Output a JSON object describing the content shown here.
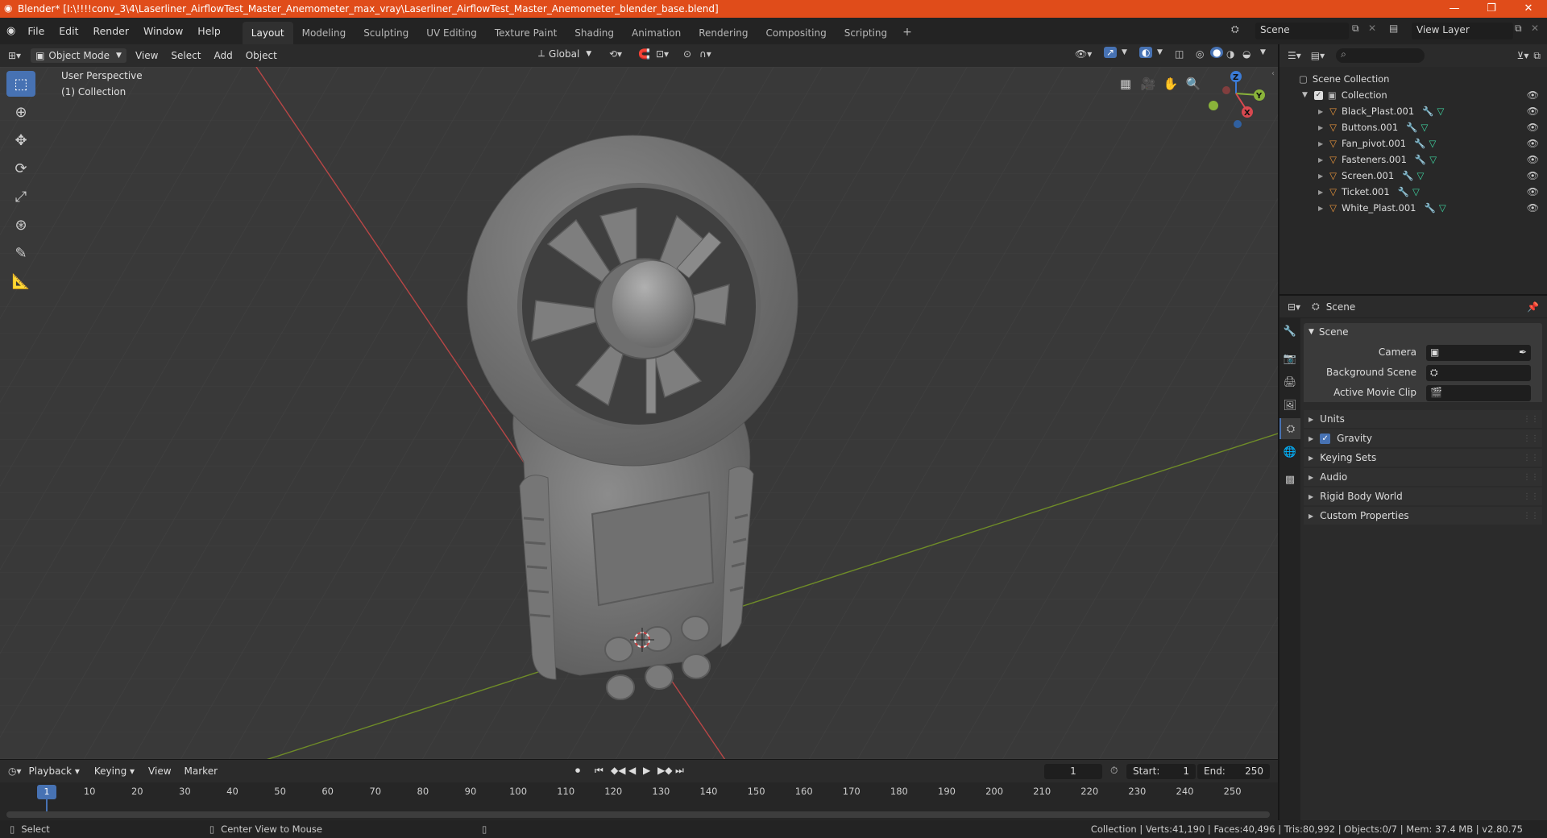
{
  "window": {
    "title": "Blender* [I:\\!!!!conv_3\\4\\Laserliner_AirflowTest_Master_Anemometer_max_vray\\Laserliner_AirflowTest_Master_Anemometer_blender_base.blend]"
  },
  "menu": [
    "File",
    "Edit",
    "Render",
    "Window",
    "Help"
  ],
  "workspaces": [
    {
      "label": "Layout",
      "active": true
    },
    {
      "label": "Modeling",
      "active": false
    },
    {
      "label": "Sculpting",
      "active": false
    },
    {
      "label": "UV Editing",
      "active": false
    },
    {
      "label": "Texture Paint",
      "active": false
    },
    {
      "label": "Shading",
      "active": false
    },
    {
      "label": "Animation",
      "active": false
    },
    {
      "label": "Rendering",
      "active": false
    },
    {
      "label": "Compositing",
      "active": false
    },
    {
      "label": "Scripting",
      "active": false
    }
  ],
  "topright": {
    "scene": "Scene",
    "view_layer": "View Layer",
    "add_tab": "+"
  },
  "viewport_header": {
    "mode": "Object Mode",
    "items": [
      "View",
      "Select",
      "Add",
      "Object"
    ],
    "orientation": "Global"
  },
  "viewport": {
    "perspective": "User Perspective",
    "collection": "(1) Collection",
    "gizmo_axes": {
      "x": "X",
      "y": "Y",
      "z": "Z"
    }
  },
  "outliner": {
    "root": "Scene Collection",
    "collection": "Collection",
    "items": [
      "Black_Plast.001",
      "Buttons.001",
      "Fan_pivot.001",
      "Fasteners.001",
      "Screen.001",
      "Ticket.001",
      "White_Plast.001"
    ]
  },
  "properties": {
    "context": "Scene",
    "panel": "Scene",
    "camera_label": "Camera",
    "background_scene_label": "Background Scene",
    "active_movie_clip_label": "Active Movie Clip",
    "subpanels": [
      "Units",
      "Gravity",
      "Keying Sets",
      "Audio",
      "Rigid Body World",
      "Custom Properties"
    ],
    "gravity_checked": true
  },
  "timeline": {
    "menus": [
      "Playback",
      "Keying",
      "View",
      "Marker"
    ],
    "current_frame": "1",
    "start_label": "Start:",
    "start": "1",
    "end_label": "End:",
    "end": "250",
    "ruler_ticks": [
      "10",
      "20",
      "30",
      "40",
      "50",
      "60",
      "70",
      "80",
      "90",
      "100",
      "110",
      "120",
      "130",
      "140",
      "150",
      "160",
      "170",
      "180",
      "190",
      "200",
      "210",
      "220",
      "230",
      "240",
      "250"
    ],
    "playhead": "1"
  },
  "statusbar": {
    "left": "Select",
    "middle": "Center View to Mouse",
    "right": "Collection | Verts:41,190 | Faces:40,496 | Tris:80,992 | Objects:0/7 | Mem: 37.4 MB | v2.80.75"
  },
  "colors": {
    "titlebar": "#e04c1a",
    "accent": "#4772b3",
    "viewport_bg": "#393939",
    "x_axis": "#c84a4a",
    "y_axis": "#7a9a2a",
    "mesh_icon": "#e8953b"
  }
}
